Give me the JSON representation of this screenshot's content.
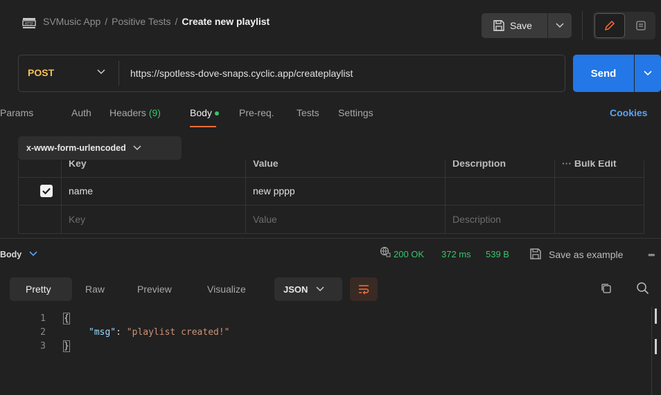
{
  "header": {
    "breadcrumbs": [
      "SVMusic App",
      "Positive Tests"
    ],
    "separator": "/",
    "current": "Create new playlist",
    "save_label": "Save"
  },
  "request": {
    "method": "POST",
    "url": "https://spotless-dove-snaps.cyclic.app/createplaylist",
    "send_label": "Send"
  },
  "tabs": {
    "params": "Params",
    "auth": "Auth",
    "headers": "Headers",
    "headers_count": "(9)",
    "body": "Body",
    "prereq": "Pre-req.",
    "tests": "Tests",
    "settings": "Settings",
    "cookies": "Cookies"
  },
  "body_type": "x-www-form-urlencoded",
  "kv_table": {
    "headers": [
      "Key",
      "Value",
      "Description",
      "Bulk Edit"
    ],
    "rows": [
      {
        "checked": true,
        "key": "name",
        "value": "new pppp",
        "description": ""
      }
    ],
    "placeholder": {
      "key": "Key",
      "value": "Value",
      "description": "Description"
    }
  },
  "response": {
    "label": "Body",
    "status": "200 OK",
    "time": "372 ms",
    "size": "539 B",
    "save_example": "Save as example",
    "more": "•••",
    "tabs": [
      "Pretty",
      "Raw",
      "Preview",
      "Visualize"
    ],
    "format": "JSON",
    "code": {
      "line_numbers": [
        "1",
        "2",
        "3"
      ],
      "open": "{",
      "key": "\"msg\"",
      "colon": ": ",
      "value": "\"playlist created!\"",
      "close": "}"
    }
  },
  "colors": {
    "accent_orange": "#ff6c37",
    "method_post": "#f6c155",
    "send_blue": "#2377e6",
    "status_green": "#35c76b",
    "cookies_link": "#5aa2f7"
  }
}
